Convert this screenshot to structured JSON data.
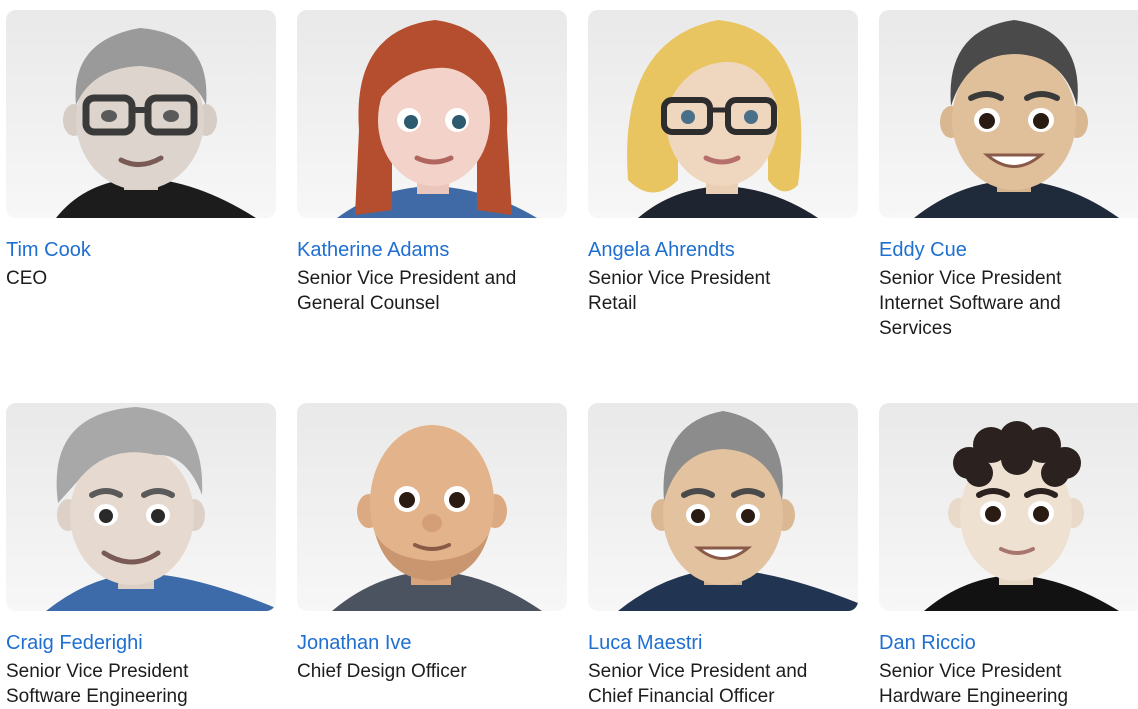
{
  "people": [
    {
      "name": "Tim Cook",
      "title_lines": [
        "CEO"
      ],
      "avatar": "memoji-tim-cook"
    },
    {
      "name": "Katherine Adams",
      "title_lines": [
        "Senior Vice President and",
        "General Counsel"
      ],
      "avatar": "memoji-katherine-adams"
    },
    {
      "name": "Angela Ahrendts",
      "title_lines": [
        "Senior Vice President",
        "Retail"
      ],
      "avatar": "memoji-angela-ahrendts"
    },
    {
      "name": "Eddy Cue",
      "title_lines": [
        "Senior Vice President",
        "Internet Software and",
        "Services"
      ],
      "avatar": "memoji-eddy-cue"
    },
    {
      "name": "Craig Federighi",
      "title_lines": [
        "Senior Vice President",
        "Software Engineering"
      ],
      "avatar": "memoji-craig-federighi"
    },
    {
      "name": "Jonathan Ive",
      "title_lines": [
        "Chief Design Officer"
      ],
      "avatar": "memoji-jonathan-ive"
    },
    {
      "name": "Luca Maestri",
      "title_lines": [
        "Senior Vice President and",
        "Chief Financial Officer"
      ],
      "avatar": "memoji-luca-maestri"
    },
    {
      "name": "Dan Riccio",
      "title_lines": [
        "Senior Vice President",
        "Hardware Engineering"
      ],
      "avatar": "memoji-dan-riccio"
    }
  ],
  "colors": {
    "link": "#1f6fd1",
    "text": "#1d1d1f",
    "tile_background": "#efefef"
  }
}
